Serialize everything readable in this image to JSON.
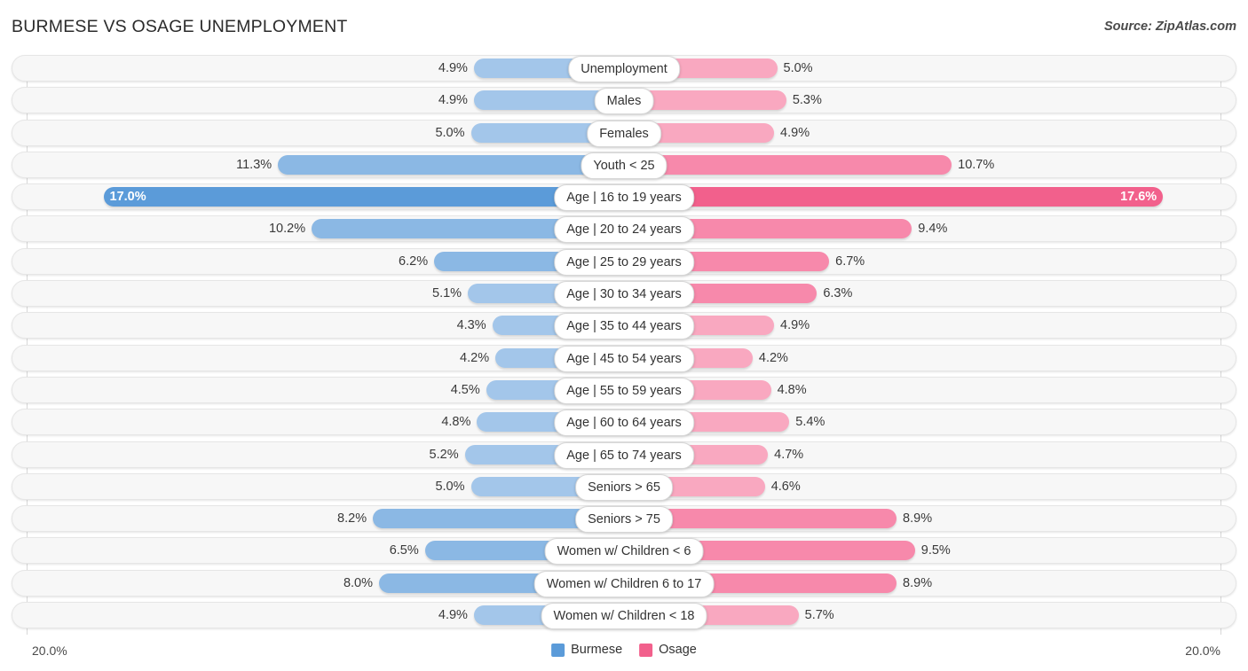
{
  "header": {
    "title": "BURMESE VS OSAGE UNEMPLOYMENT",
    "source": "Source: ZipAtlas.com"
  },
  "footer": {
    "axis_left": "20.0%",
    "axis_right": "20.0%",
    "legend": [
      {
        "label": "Burmese",
        "color": "#5b9bd9"
      },
      {
        "label": "Osage",
        "color": "#f2608c"
      }
    ]
  },
  "colors": {
    "burmese_light": "#a3c6ea",
    "burmese_mid": "#8bb8e4",
    "burmese_dark": "#5b9bd9",
    "osage_light": "#f9a8c0",
    "osage_mid": "#f789ab",
    "osage_dark": "#f2608c",
    "track": "#f7f7f7",
    "gridline": "#d8d8d8"
  },
  "chart_data": {
    "type": "bar",
    "orientation": "horizontal-diverging",
    "title": "BURMESE VS OSAGE UNEMPLOYMENT",
    "xlabel": "",
    "ylabel": "",
    "axis_max": 20.0,
    "axis_unit": "%",
    "grid": true,
    "legend_position": "bottom-center",
    "categories": [
      "Unemployment",
      "Males",
      "Females",
      "Youth < 25",
      "Age | 16 to 19 years",
      "Age | 20 to 24 years",
      "Age | 25 to 29 years",
      "Age | 30 to 34 years",
      "Age | 35 to 44 years",
      "Age | 45 to 54 years",
      "Age | 55 to 59 years",
      "Age | 60 to 64 years",
      "Age | 65 to 74 years",
      "Seniors > 65",
      "Seniors > 75",
      "Women w/ Children < 6",
      "Women w/ Children 6 to 17",
      "Women w/ Children < 18"
    ],
    "series": [
      {
        "name": "Burmese",
        "side": "left",
        "color": "#5b9bd9",
        "values": [
          4.9,
          4.9,
          5.0,
          11.3,
          17.0,
          10.2,
          6.2,
          5.1,
          4.3,
          4.2,
          4.5,
          4.8,
          5.2,
          5.0,
          8.2,
          6.5,
          8.0,
          4.9
        ],
        "labels": [
          "4.9%",
          "4.9%",
          "5.0%",
          "11.3%",
          "17.0%",
          "10.2%",
          "6.2%",
          "5.1%",
          "4.3%",
          "4.2%",
          "4.5%",
          "4.8%",
          "5.2%",
          "5.0%",
          "8.2%",
          "6.5%",
          "8.0%",
          "4.9%"
        ]
      },
      {
        "name": "Osage",
        "side": "right",
        "color": "#f2608c",
        "values": [
          5.0,
          5.3,
          4.9,
          10.7,
          17.6,
          9.4,
          6.7,
          6.3,
          4.9,
          4.2,
          4.8,
          5.4,
          4.7,
          4.6,
          8.9,
          9.5,
          8.9,
          5.7
        ],
        "labels": [
          "5.0%",
          "5.3%",
          "4.9%",
          "10.7%",
          "17.6%",
          "9.4%",
          "6.7%",
          "6.3%",
          "4.9%",
          "4.2%",
          "4.8%",
          "5.4%",
          "4.7%",
          "4.6%",
          "8.9%",
          "9.5%",
          "8.9%",
          "5.7%"
        ]
      }
    ]
  }
}
